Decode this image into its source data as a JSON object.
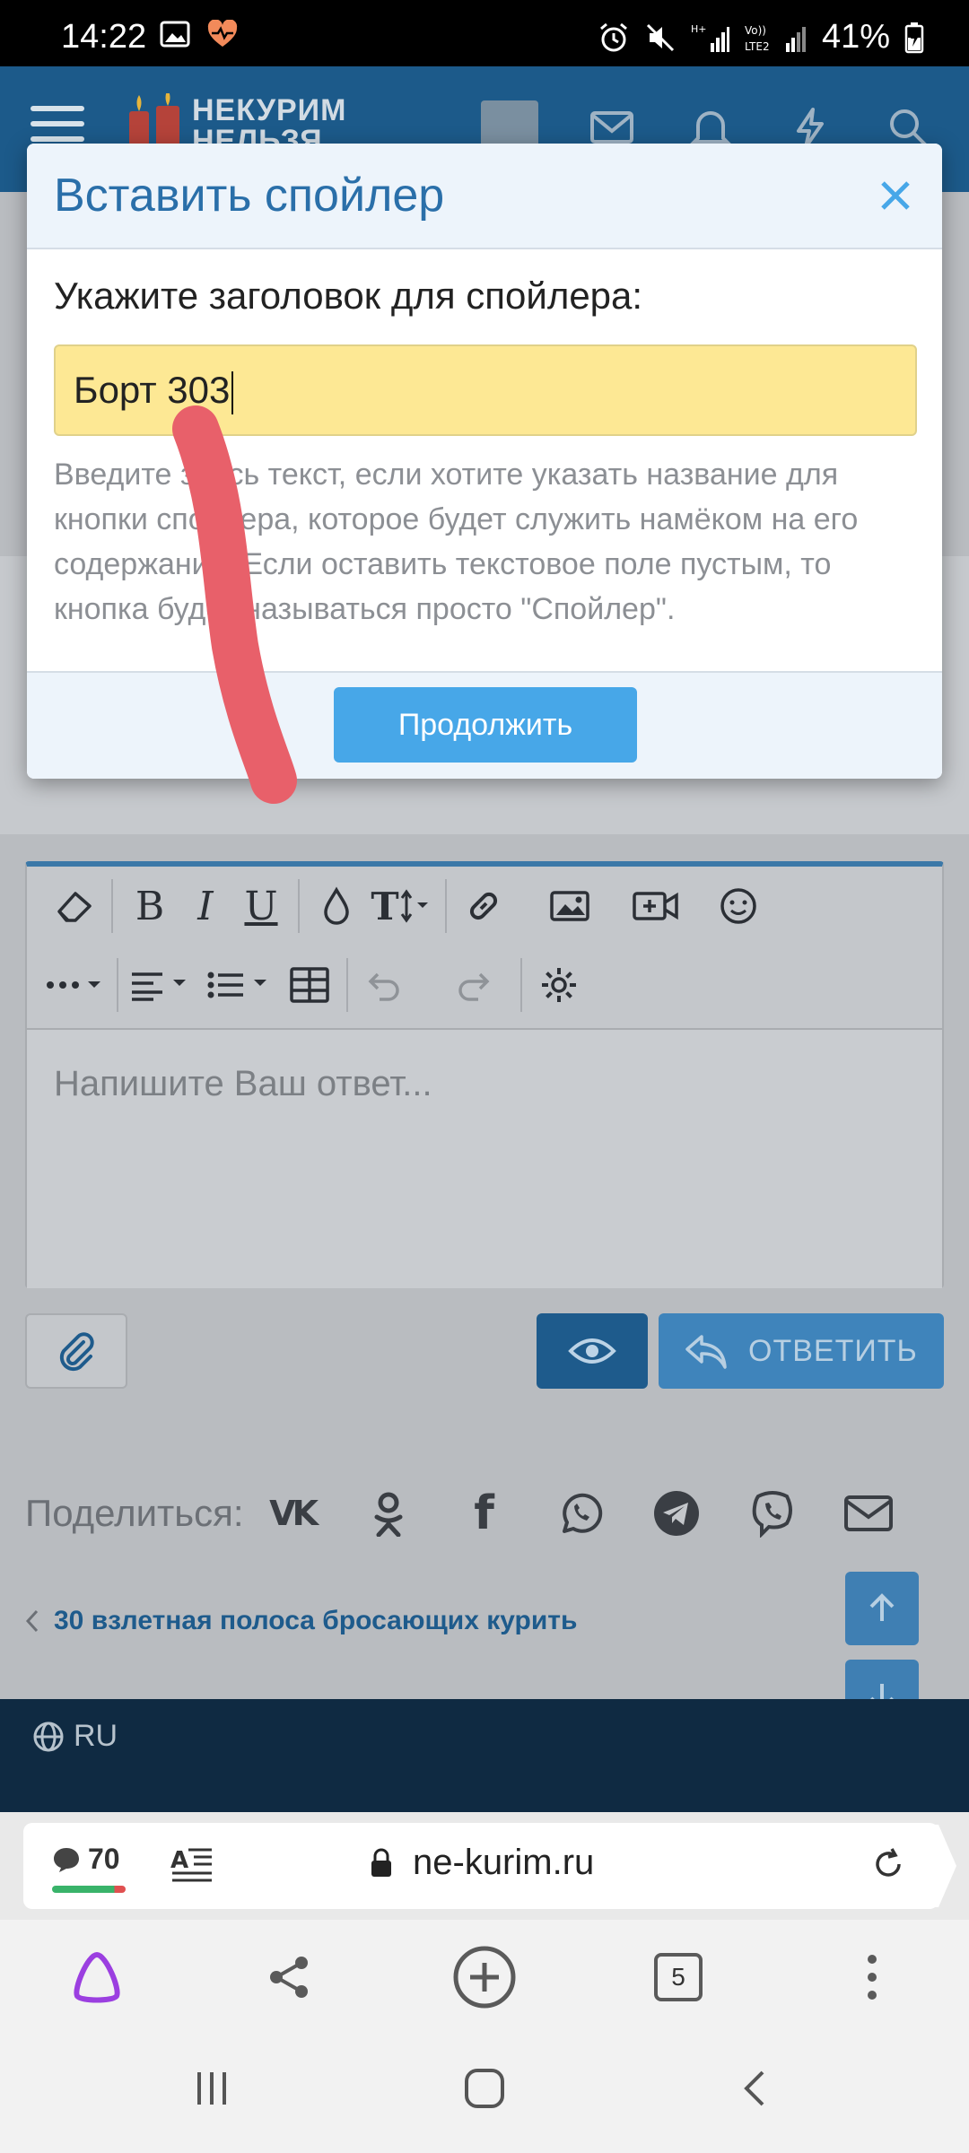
{
  "status_bar": {
    "time": "14:22",
    "battery": "41%",
    "network": "LTE2"
  },
  "header": {
    "logo_line1": "НЕКУРИМ",
    "logo_line2": "НЕЛЬЗЯ"
  },
  "modal": {
    "title": "Вставить спойлер",
    "label": "Укажите заголовок для спойлера:",
    "input_value": "Борт 303",
    "help": "Введите здесь текст, если хотите указать название для кнопки спойлера, которое будет служить намёком на его содержание. Если оставить текстовое поле пустым, то кнопка будет называться просто \"Спойлер\".",
    "continue": "Продолжить"
  },
  "editor": {
    "placeholder": "Напишите Ваш ответ..."
  },
  "actions": {
    "reply": "ОТВЕТИТЬ"
  },
  "share": {
    "label": "Поделиться:"
  },
  "thread": {
    "prev_link": "30 взлетная полоса бросающих курить"
  },
  "footer": {
    "lang": "RU"
  },
  "browser": {
    "comments": "70",
    "url": "ne-kurim.ru",
    "tabs": "5"
  },
  "colors": {
    "accent": "#2a6fa9",
    "input_bg": "#fde894",
    "button": "#47a7e8",
    "annotation": "#e8606a"
  }
}
